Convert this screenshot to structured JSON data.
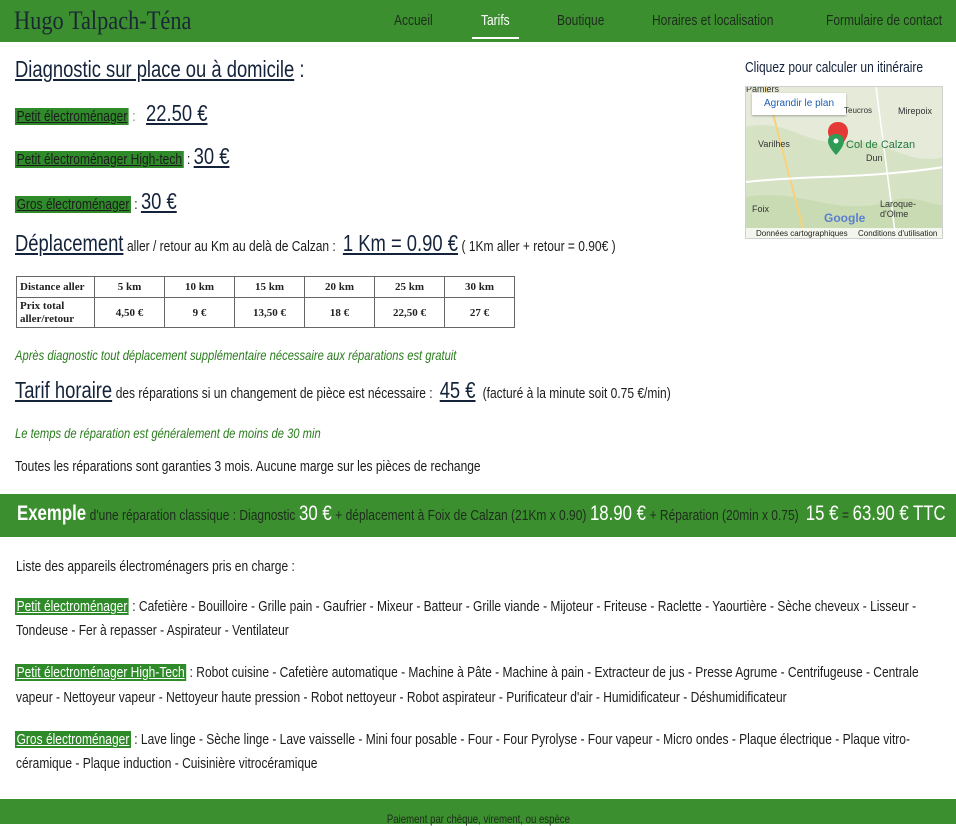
{
  "nav": {
    "brand": "Hugo Talpach-Téna",
    "items": [
      "Accueil",
      "Tarifs",
      "Boutique",
      "Horaires et localisation",
      "Formulaire de contact"
    ],
    "active": "Tarifs"
  },
  "main": {
    "title": "Diagnostic sur place ou à domicile",
    "title_colon": " :",
    "prices": [
      {
        "label": "Petit électroménager",
        "sep": " : ",
        "value": "22.50 €"
      },
      {
        "label": "Petit électroménager High-tech",
        "sep": " : ",
        "value": "30 €"
      },
      {
        "label": "Gros électroménager",
        "sep": " : ",
        "value": "30 €"
      }
    ],
    "deplacement": {
      "heading": "Déplacement",
      "text": "aller / retour au Km au delà de Calzan :",
      "value": "1 Km = 0.90 €",
      "note": "( 1Km aller + retour = 0.90€ )"
    },
    "table": {
      "header": [
        "Distance aller",
        "5 km",
        "10 km",
        "15 km",
        "20 km",
        "25 km",
        "30 km"
      ],
      "row_label": "Prix total aller/retour",
      "row": [
        "4,50 €",
        "9 €",
        "13,50 €",
        "18 €",
        "22,50 €",
        "27 €"
      ]
    },
    "note_after_diag": "Après diagnostic tout déplacement supplémentaire nécessaire aux réparations est gratuit",
    "tarif": {
      "heading": "Tarif horaire",
      "text": "des réparations si un changement de pièce est nécessaire :",
      "value": "45 €",
      "note": "(facturé à la minute soit 0.75 €/min)"
    },
    "note_time": "Le temps de réparation est généralement de moins de 30 min",
    "guarantee": "Toutes les réparations sont garanties 3 mois. Aucune marge sur les pièces de rechange"
  },
  "map": {
    "title": "Cliquez pour calculer un itinéraire",
    "link": "Agrandir le plan",
    "places": [
      "Pamiers",
      "Mirepoix",
      "Varilhes",
      "Dun",
      "Foix",
      "Laroque-d'Olme",
      "Col de Calzan",
      "Teucros"
    ],
    "footer": [
      "Données cartographiques",
      "Conditions d'utilisation"
    ],
    "logo": "Google"
  },
  "example": {
    "label": "Exemple",
    "t1": "d'une réparation classique : Diagnostic",
    "v1": "30 €",
    "t2": "+ déplacement à Foix de Calzan (21Km x 0.90)",
    "v2": "18.90 €",
    "t3": "+ Réparation (20min x 0.75)",
    "v3": "15 €",
    "t4": "=",
    "v4": "63.90 € TTC"
  },
  "list": {
    "intro": "Liste des appareils électroménagers pris en charge :",
    "categories": [
      {
        "label": "Petit électroménager",
        "line1": ": Cafetière - Bouilloire - Grille pain - Gaufrier - Mixeur - Batteur - Grille viande - Mijoteur - Friteuse - Raclette - Yaourtière - Sèche cheveux - Lisseur -",
        "line2": "Tondeuse - Fer à repasser - Aspirateur - Ventilateur"
      },
      {
        "label": "Petit électroménager High-Tech",
        "line1": ": Robot cuisine - Cafetière automatique - Machine à Pâte - Machine à pain - Extracteur de jus - Presse Agrume - Centrifugeuse - Centrale",
        "line2": "vapeur - Nettoyeur vapeur - Nettoyeur haute pression - Robot nettoyeur - Robot aspirateur - Purificateur d'air - Humidificateur - Déshumidificateur"
      },
      {
        "label": "Gros électroménager",
        "line1": ": Lave linge - Sèche linge - Lave vaisselle - Mini four posable - Four - Four Pyrolyse - Four vapeur - Micro ondes - Plaque électrique - Plaque vitro-",
        "line2": "céramique - Plaque induction - Cuisinière vitrocéramique"
      }
    ]
  },
  "footer": {
    "text": "Paiement par chèque, virement, ou espèce"
  },
  "colors": {
    "green": "#3c8f2e",
    "tag": "#2f8a2a",
    "navy": "#14233a"
  }
}
